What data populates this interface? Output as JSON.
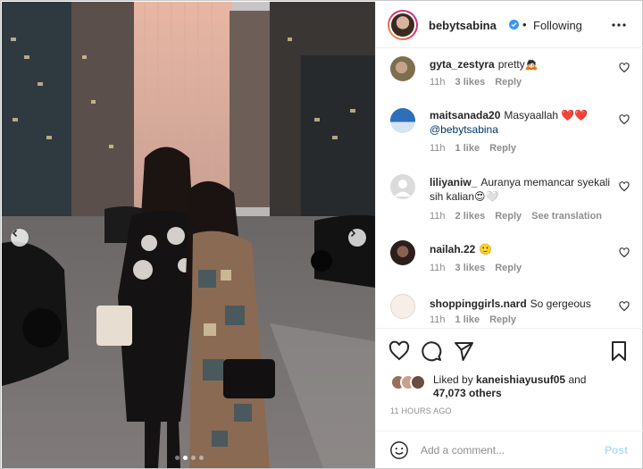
{
  "post": {
    "image_icon_prev": "chevron-left-icon",
    "image_icon_next": "chevron-right-icon",
    "carousel_dots": 4,
    "carousel_active": 1
  },
  "header": {
    "username": "bebytsabina",
    "separator": "•",
    "follow_label": "Following"
  },
  "comments": [
    {
      "user": "gyta_zestyra",
      "text": "pretty🙇🏻",
      "time": "11h",
      "likes": "3 likes",
      "reply": "Reply",
      "extra": ""
    },
    {
      "user": "maitsanada20",
      "text": "Masyaallah ❤️❤️",
      "mention": "@bebytsabina",
      "time": "11h",
      "likes": "1 like",
      "reply": "Reply",
      "extra": ""
    },
    {
      "user": "liliyaniw_",
      "text": "Auranya memancar syekali sih kalian😍🤍",
      "time": "11h",
      "likes": "2 likes",
      "reply": "Reply",
      "extra": "See translation"
    },
    {
      "user": "nailah.22",
      "text": "🙂",
      "time": "11h",
      "likes": "3 likes",
      "reply": "Reply",
      "extra": ""
    },
    {
      "user": "shoppinggirls.nard",
      "text": "So gergeous",
      "time": "11h",
      "likes": "1 like",
      "reply": "Reply",
      "extra": ""
    }
  ],
  "likes": {
    "prefix": "Liked by",
    "user": "kaneishiayusuf05",
    "middle": "and",
    "count": "47,073 others"
  },
  "timestamp": "11 HOURS AGO",
  "composer": {
    "placeholder": "Add a comment...",
    "post_label": "Post"
  },
  "colors": {
    "accent": "#0095f6",
    "post_disabled": "#b2dffc",
    "secondary_text": "#8e8e8e",
    "mention": "#00376b"
  }
}
